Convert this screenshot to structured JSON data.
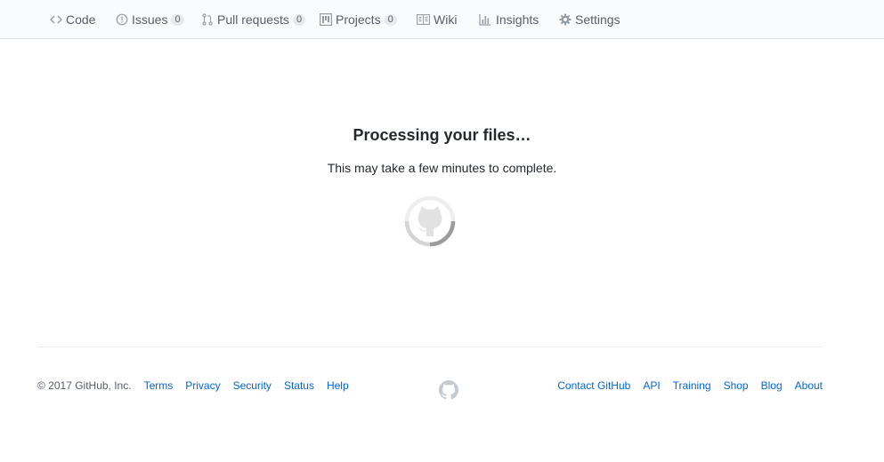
{
  "tabs": [
    {
      "label": "Code",
      "icon": "code-icon"
    },
    {
      "label": "Issues",
      "icon": "issue-icon",
      "count": "0"
    },
    {
      "label": "Pull requests",
      "icon": "pull-request-icon",
      "count": "0"
    },
    {
      "label": "Projects",
      "icon": "project-icon",
      "count": "0"
    },
    {
      "label": "Wiki",
      "icon": "book-icon"
    },
    {
      "label": "Insights",
      "icon": "graph-icon"
    },
    {
      "label": "Settings",
      "icon": "gear-icon"
    }
  ],
  "main": {
    "title": "Processing your files…",
    "subtitle": "This may take a few minutes to complete.",
    "spinner_icon": "octocat-spinner-icon"
  },
  "footer": {
    "copyright": "© 2017 GitHub, Inc.",
    "left_links": [
      "Terms",
      "Privacy",
      "Security",
      "Status",
      "Help"
    ],
    "right_links": [
      "Contact GitHub",
      "API",
      "Training",
      "Shop",
      "Blog",
      "About"
    ],
    "logo_icon": "github-mark-icon"
  },
  "colors": {
    "link": "#0366d6",
    "muted": "#586069",
    "border": "#e1e4e8"
  }
}
